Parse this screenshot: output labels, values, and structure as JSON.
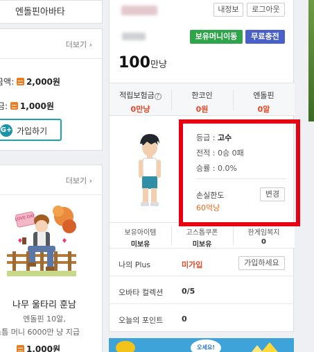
{
  "left": {
    "top_title": "엔돌핀아바타",
    "mid_more": "더보기",
    "row1_label": "금액:",
    "row1_value": "2,000원",
    "row2_label": "금:",
    "row2_value": "1,000원",
    "join_label": "가입하기",
    "bot_more": "더보기",
    "avatar_name": "나무 울타리 훈남",
    "desc1": "엔돌핀 10알,",
    "desc2": "스틈 머니 6000만 냥 지급",
    "price": "1,000원",
    "card_text": "LOVE DAY"
  },
  "main": {
    "my_info_btn": "내정보",
    "logout_btn": "로그아웃",
    "money_transfer_btn": "보유머니이동",
    "free_charge_btn": "무료충전",
    "money_amount": "100",
    "money_unit": "만냥",
    "stats": [
      {
        "label": "적립보험금",
        "value": "0만냥"
      },
      {
        "label": "한코인",
        "value": "0원"
      },
      {
        "label": "엔돌핀",
        "value": "0알"
      }
    ],
    "grade_label": "등급 : ",
    "grade_value": "고수",
    "record_label": "전적 : ",
    "record_value": "0승 0패",
    "winrate_label": "승률 : ",
    "winrate_value": "0.0%",
    "loss_limit_label": "손실한도",
    "loss_limit_value": "60억냥",
    "change_btn": "변경",
    "cells": [
      {
        "label": "보유아이템",
        "value": "미보유"
      },
      {
        "label": "고스톱쿠폰",
        "value": "미보유"
      },
      {
        "label": "한게임복지",
        "value": "0"
      }
    ],
    "plus_label": "나의 Plus",
    "plus_value": "미가입",
    "plus_btn": "가입하세요",
    "collection_label": "오바타 컬렉션",
    "collection_value": "0/5",
    "points_label": "오늘의 포인트",
    "points_value": "0",
    "banner_text": "오세요!"
  },
  "colors": {
    "highlight_box": "#e60012",
    "accent_red": "#e44826",
    "join_border": "#19a2b4",
    "green_btn": "#2ea54a",
    "blue_btn": "#4a60c9"
  }
}
